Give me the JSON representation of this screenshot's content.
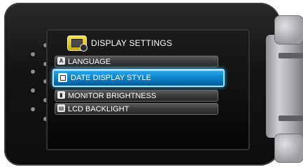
{
  "menu": {
    "title": "DISPLAY SETTINGS",
    "title_icon": "display-settings-icon",
    "items": [
      {
        "label": "LANGUAGE",
        "icon": "language-icon",
        "selected": false
      },
      {
        "label": "DATE DISPLAY STYLE",
        "icon": "date-display-icon",
        "selected": true
      },
      {
        "label": "MONITOR BRIGHTNESS",
        "icon": "brightness-icon",
        "selected": false
      },
      {
        "label": "LCD BACKLIGHT",
        "icon": "backlight-icon",
        "selected": false
      }
    ]
  },
  "colors": {
    "selection": "#0a7fc6",
    "selection_border": "#a8e6ff",
    "title_icon": "#e8c830",
    "text": "#ffffff"
  }
}
